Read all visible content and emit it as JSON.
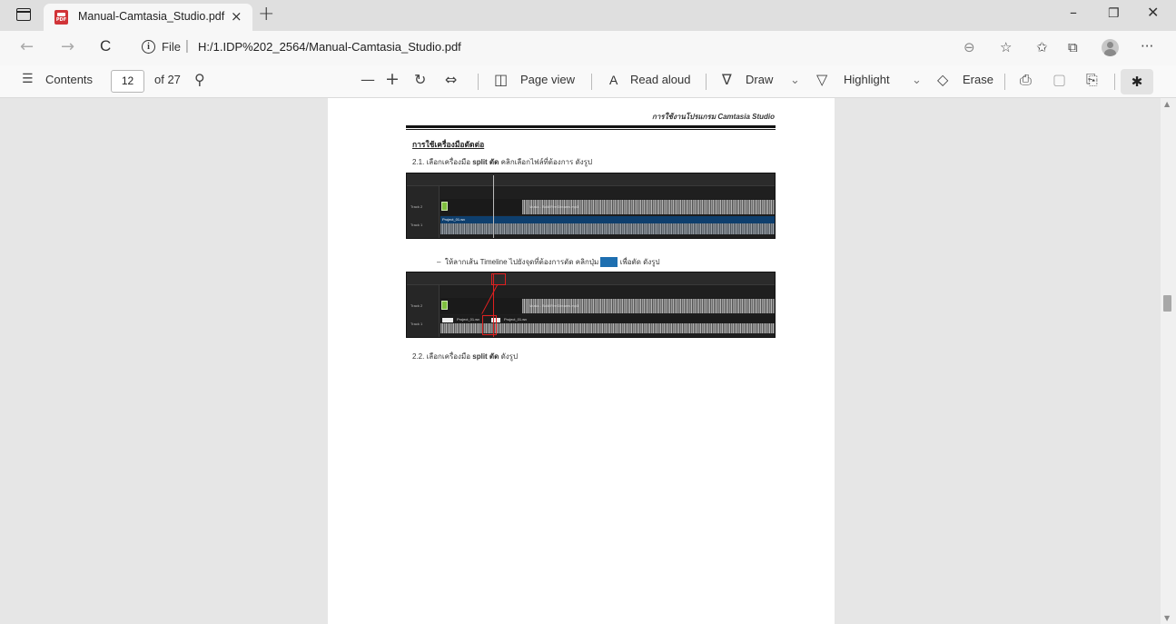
{
  "browser": {
    "tab_title": "Manual-Camtasia_Studio.pdf",
    "tab_close": "×",
    "new_tab": "+",
    "window_controls": {
      "minimize": "–",
      "restore": "❐",
      "close": "✕"
    }
  },
  "address_bar": {
    "back": "←",
    "forward": "→",
    "refresh": "C",
    "info_icon": "i",
    "file_label": "File",
    "separator": "|",
    "url": "H:/1.IDP%202_2564/Manual-Camtasia_Studio.pdf",
    "icons": {
      "zoom": "⊖",
      "favorite_add": "☆",
      "favorites": "✩",
      "collections": "⧉",
      "more": "···"
    }
  },
  "pdf_toolbar": {
    "contents_icon": "☰",
    "contents_label": "Contents",
    "page_number": "12",
    "page_total": "of 27",
    "search_icon": "⚲",
    "zoom_out": "—",
    "zoom_in": "+",
    "rotate_icon": "↻",
    "fit_icon": "⇔",
    "page_view_icon": "◫",
    "page_view_label": "Page view",
    "read_aloud_icon": "A",
    "read_aloud_label": "Read aloud",
    "draw_icon": "∇",
    "draw_label": "Draw",
    "highlight_icon": "▽",
    "highlight_label": "Highlight",
    "dropdown_icon": "⌄",
    "erase_icon": "◇",
    "erase_label": "Erase",
    "print_icon": "⎙",
    "save_icon": "▢",
    "save_as_icon": "⎘",
    "pin_icon": "✱"
  },
  "document": {
    "running_header": "การใช้งานโปรแกรม Camtasia Studio",
    "section_heading": "การใช้เครื่องมือตัดต่อ",
    "step_2_1": {
      "prefix": "2.1.  เลือกเครื่องมือ",
      "bold": "split ตัด",
      "suffix": "คลิกเลือกไฟล์ที่ต้องการ ดังรูป"
    },
    "bullet": {
      "dash": "–",
      "text_before": "ให้ลากเส้น Timeline ไปยังจุดที่ต้องการตัด คลิกปุ่ม",
      "text_after": "เพื่อตัด ดังรูป"
    },
    "step_2_2": {
      "prefix": "2.2.  เลือกเครื่องมือ",
      "bold": "split ตัด",
      "suffix": "ดังรูป"
    }
  },
  "timeline": {
    "track2_label": "Track 2",
    "track1_label": "Track 1",
    "clip_label": "Project_01.wv",
    "clip_label_2": "Project_01.wv",
    "audio_label": "Music - Bold Fire Dreams.mp3"
  },
  "colors": {
    "timeline_bg": "#1f1f1f",
    "track1_bg": "#0e3f6e",
    "annotation_red": "#e02020",
    "pdf_icon": "#d13438"
  }
}
